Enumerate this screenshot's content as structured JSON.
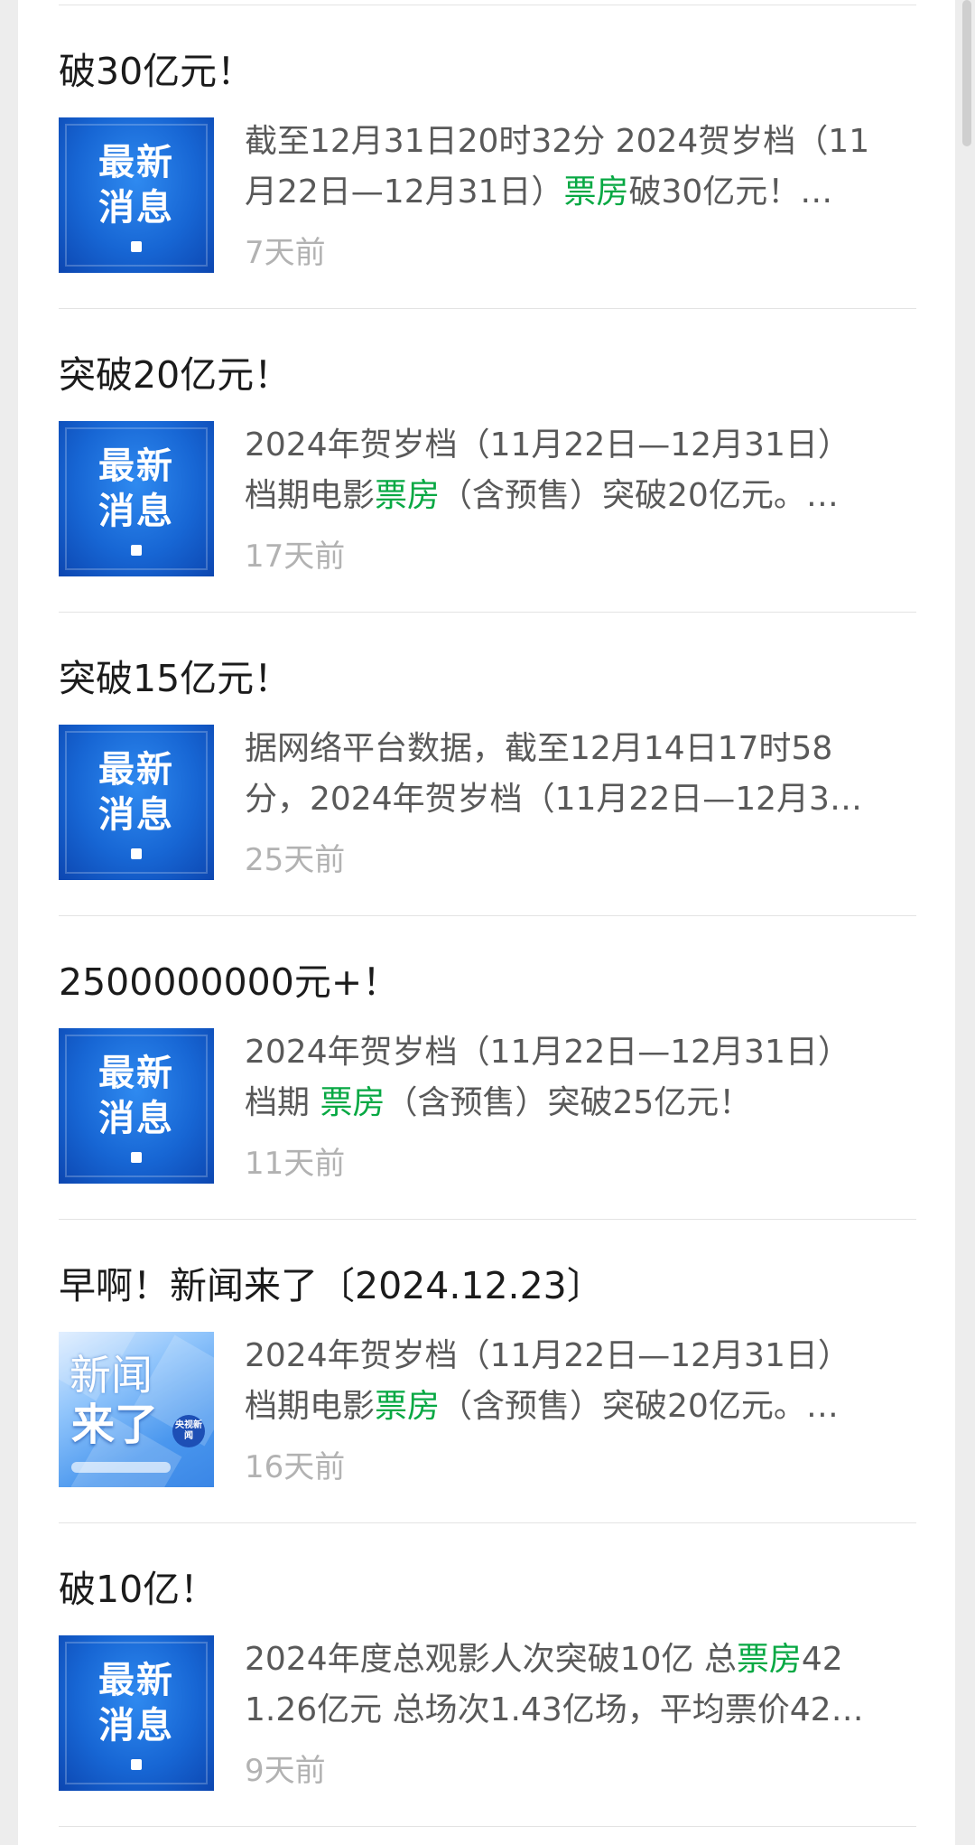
{
  "articles": [
    {
      "title": "破30亿元！",
      "thumbnail": "最新消息",
      "thumb_line1": "最新",
      "thumb_line2": "消息",
      "line1": "截至12月31日20时32分 2024贺岁档（11",
      "line2_pre": "月22日—12月31日）",
      "highlight": "票房",
      "line2_post": "破30亿元！…",
      "time": "7天前"
    },
    {
      "title": "突破20亿元！",
      "thumbnail": "最新消息",
      "thumb_line1": "最新",
      "thumb_line2": "消息",
      "line1": "2024年贺岁档（11月22日—12月31日）",
      "line2_pre": "档期电影",
      "highlight": "票房",
      "line2_post": "（含预售）突破20亿元。…",
      "time": "17天前"
    },
    {
      "title": "突破15亿元！",
      "thumbnail": "最新消息",
      "thumb_line1": "最新",
      "thumb_line2": "消息",
      "line1": "据网络平台数据，截至12月14日17时58",
      "line2_pre": "分，2024年贺岁档（11月22日—12月3…",
      "highlight": "",
      "line2_post": "",
      "time": "25天前"
    },
    {
      "title": "2500000000元+！",
      "thumbnail": "最新消息",
      "thumb_line1": "最新",
      "thumb_line2": "消息",
      "line1": "2024年贺岁档（11月22日—12月31日）",
      "line2_pre": "档期 ",
      "highlight": "票房",
      "line2_post": "（含预售）突破25亿元！",
      "time": "11天前"
    },
    {
      "title": "早啊！新闻来了〔2024.12.23〕",
      "thumbnail": "新闻来了",
      "thumb_line1": "新闻",
      "thumb_line2": "来了",
      "thumb_badge": "央视新闻",
      "line1": "2024年贺岁档（11月22日—12月31日）",
      "line2_pre": "档期电影",
      "highlight": "票房",
      "line2_post": "（含预售）突破20亿元。…",
      "time": "16天前"
    },
    {
      "title": "破10亿！",
      "thumbnail": "最新消息",
      "thumb_line1": "最新",
      "thumb_line2": "消息",
      "line1_pre": "2024年度总观影人次突破10亿 总",
      "line1_highlight": "票房",
      "line1_post": "42",
      "line2_pre": "1.26亿元 总场次1.43亿场，平均票价42…",
      "highlight": "",
      "line2_post": "",
      "time": "9天前"
    }
  ],
  "colors": {
    "highlight": "#07a843",
    "title": "#1b1b1b",
    "excerpt": "#595959",
    "time": "#b2b2b2",
    "background": "#ededed"
  }
}
